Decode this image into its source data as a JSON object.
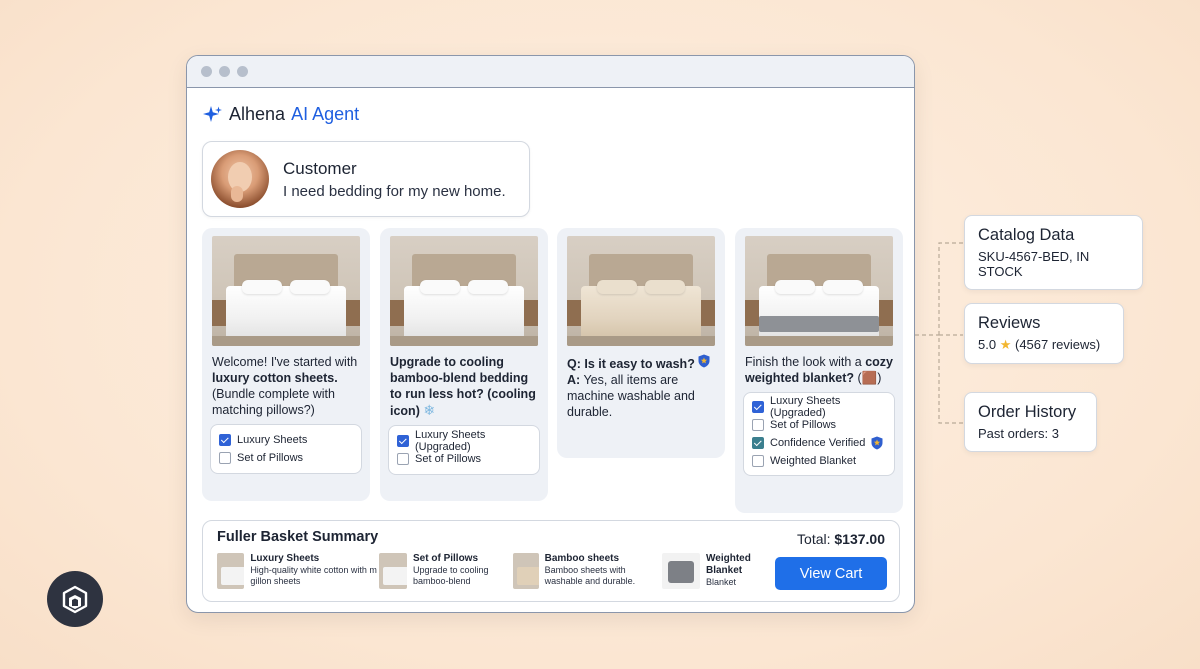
{
  "brand": {
    "name": "Alhena",
    "accent": "AI Agent",
    "accent_color": "#1f5fe0"
  },
  "customer": {
    "title": "Customer",
    "message": "I need bedding for my new home."
  },
  "cards": [
    {
      "text_pre": "Welcome! I've started with ",
      "text_bold": "luxury cotton sheets.",
      "text_post": " (Bundle complete with matching pillows?)",
      "checks": [
        {
          "label": "Luxury Sheets",
          "checked": true
        },
        {
          "label": "Set of Pillows",
          "checked": false
        }
      ]
    },
    {
      "text_bold": "Upgrade to cooling bamboo-blend bedding to run less hot? (cooling icon)",
      "checks": [
        {
          "label": "Luxury Sheets (Upgraded)",
          "checked": true
        },
        {
          "label": "Set of Pillows",
          "checked": false
        }
      ]
    },
    {
      "q_label": "Q:",
      "q_text": "Is it easy to wash?",
      "a_label": "A:",
      "a_text": "Yes, all items are machine washable and durable."
    },
    {
      "text_pre": "Finish the look with a ",
      "text_bold": "cozy weighted blanket?",
      "text_emoji": " (🟫)",
      "checks": [
        {
          "label": "Luxury Sheets (Upgraded)",
          "checked": true
        },
        {
          "label": "Set of Pillows",
          "checked": false
        },
        {
          "label": "Confidence Verified",
          "checked": true
        },
        {
          "label": "Weighted Blanket",
          "checked": false
        }
      ]
    }
  ],
  "summary": {
    "title": "Fuller Basket Summary",
    "total_label": "Total:",
    "total_value": "$137.00",
    "view_cart": "View Cart",
    "items": [
      {
        "name": "Luxury Sheets",
        "desc": "High-quality white cotton with m gillon sheets"
      },
      {
        "name": "Set of Pillows",
        "desc": "Upgrade to cooling bamboo-blend"
      },
      {
        "name": "Bamboo sheets",
        "desc": "Bamboo sheets with washable and durable."
      },
      {
        "name": "Weighted Blanket",
        "desc": "Blanket"
      }
    ]
  },
  "side": {
    "catalog": {
      "title": "Catalog Data",
      "sub": "SKU-4567-BED, IN STOCK"
    },
    "reviews": {
      "title": "Reviews",
      "rating": "5.0",
      "count": "(4567 reviews)"
    },
    "orders": {
      "title": "Order History",
      "sub": "Past orders: 3"
    }
  },
  "colors": {
    "primary_button": "#1f6fe8",
    "checkbox": "#2f62d6",
    "background": "#fbe8d6"
  }
}
